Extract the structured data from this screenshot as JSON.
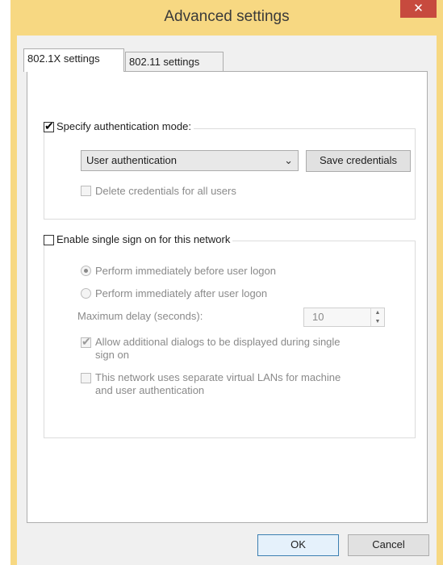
{
  "window": {
    "title": "Advanced settings",
    "close_glyph": "✕"
  },
  "tabs": [
    {
      "label": "802.1X settings",
      "selected": true
    },
    {
      "label": "802.11 settings",
      "selected": false
    }
  ],
  "auth_group": {
    "specify_mode_label": "Specify authentication mode:",
    "specify_mode_checked": true,
    "mode_select_value": "User authentication",
    "save_credentials_label": "Save credentials",
    "delete_credentials_label": "Delete credentials for all users",
    "delete_credentials_checked": false
  },
  "sso_group": {
    "enable_sso_label": "Enable single sign on for this network",
    "enable_sso_checked": false,
    "radio_before_label": "Perform immediately before user logon",
    "radio_before_selected": true,
    "radio_after_label": "Perform immediately after user logon",
    "max_delay_label": "Maximum delay (seconds):",
    "max_delay_value": "10",
    "allow_dialogs_line1": "Allow additional dialogs to be displayed during single",
    "allow_dialogs_line2": "sign on",
    "allow_dialogs_checked": true,
    "separate_vlans_line1": "This network uses separate virtual LANs for machine",
    "separate_vlans_line2": "and user authentication",
    "separate_vlans_checked": false
  },
  "footer": {
    "ok_label": "OK",
    "cancel_label": "Cancel"
  },
  "icons": {
    "checkmark": "✔",
    "dropdown": "⌄",
    "spin_up": "▲",
    "spin_down": "▼"
  },
  "colors": {
    "title_bar": "#f7d882",
    "close_button": "#c74a3e",
    "panel": "#ffffff",
    "default_button_border": "#3c7fb1"
  }
}
